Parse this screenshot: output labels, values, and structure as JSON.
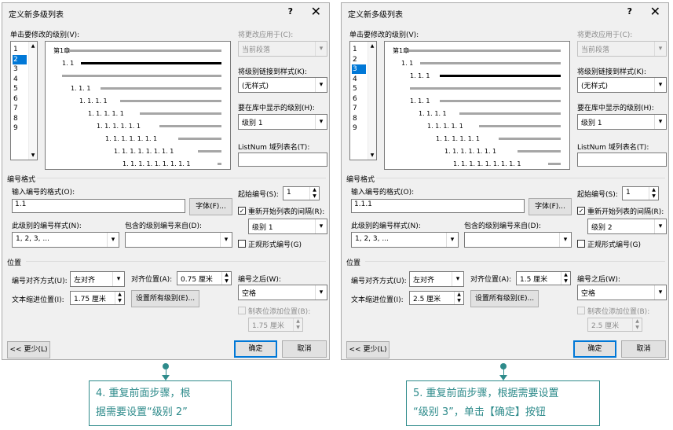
{
  "dialogs": [
    {
      "title": "定义新多级列表",
      "help_glyph": "?",
      "close_glyph": "✕",
      "level_list_label": "单击要修改的级别(V):",
      "levels": [
        "1",
        "2",
        "3",
        "4",
        "5",
        "6",
        "7",
        "8",
        "9"
      ],
      "selected_level_index": 1,
      "preview_lines": [
        {
          "text": "第1章",
          "indent": 0
        },
        {
          "text": "1. 1",
          "indent": 1
        },
        {
          "text": "",
          "indent": 1
        },
        {
          "text": "1. 1. 1",
          "indent": 2
        },
        {
          "text": "1. 1. 1. 1",
          "indent": 3
        },
        {
          "text": "1. 1. 1. 1. 1",
          "indent": 4
        },
        {
          "text": "1. 1. 1. 1. 1. 1",
          "indent": 5
        },
        {
          "text": "1. 1. 1. 1. 1. 1. 1",
          "indent": 6
        },
        {
          "text": "1. 1. 1. 1. 1. 1. 1. 1",
          "indent": 7
        },
        {
          "text": "1. 1. 1. 1. 1. 1. 1. 1. 1",
          "indent": 8
        }
      ],
      "current_preview_line": 1,
      "apply_to_label": "将更改应用于(C):",
      "apply_to_value": "当前段落",
      "link_style_label": "将级别链接到样式(K):",
      "link_style_value": "(无样式)",
      "gallery_level_label": "要在库中显示的级别(H):",
      "gallery_level_value": "级别 1",
      "listnum_label": "ListNum 域列表名(T):",
      "listnum_value": "",
      "number_format_section": "编号格式",
      "enter_format_label": "输入编号的格式(O):",
      "format_value": "1.1",
      "font_button": "字体(F)...",
      "number_style_label": "此级别的编号样式(N):",
      "number_style_value": "1, 2, 3, ...",
      "include_from_label": "包含的级别编号来自(D):",
      "include_from_value": "",
      "start_at_label": "起始编号(S):",
      "start_at_value": "1",
      "restart_label": "重新开始列表的间隔(R):",
      "restart_checked": "✓",
      "restart_value": "级别 1",
      "legal_label": "正规形式编号(G)",
      "position_section": "位置",
      "alignment_label": "编号对齐方式(U):",
      "alignment_value": "左对齐",
      "aligned_at_label": "对齐位置(A):",
      "aligned_at_value": "0.75 厘米",
      "follow_label": "编号之后(W):",
      "follow_value": "空格",
      "indent_label": "文本缩进位置(I):",
      "indent_value": "1.75 厘米",
      "set_all_button": "设置所有级别(E)...",
      "tab_stop_label": "制表位添加位置(B):",
      "tab_stop_value": "1.75 厘米",
      "less_button": "<< 更少(L)",
      "ok_button": "确定",
      "cancel_button": "取消"
    },
    {
      "title": "定义新多级列表",
      "help_glyph": "?",
      "close_glyph": "✕",
      "level_list_label": "单击要修改的级别(V):",
      "levels": [
        "1",
        "2",
        "3",
        "4",
        "5",
        "6",
        "7",
        "8",
        "9"
      ],
      "selected_level_index": 2,
      "preview_lines": [
        {
          "text": "第1章",
          "indent": 0
        },
        {
          "text": "1. 1",
          "indent": 1
        },
        {
          "text": "1. 1. 1",
          "indent": 2
        },
        {
          "text": "",
          "indent": 2
        },
        {
          "text": "1. 1. 1",
          "indent": 2
        },
        {
          "text": "1. 1. 1. 1",
          "indent": 3
        },
        {
          "text": "1. 1. 1. 1. 1",
          "indent": 4
        },
        {
          "text": "1. 1. 1. 1. 1. 1",
          "indent": 5
        },
        {
          "text": "1. 1. 1. 1. 1. 1. 1",
          "indent": 6
        },
        {
          "text": "1. 1. 1. 1. 1. 1. 1. 1. 1",
          "indent": 7
        }
      ],
      "current_preview_line": 2,
      "apply_to_label": "将更改应用于(C):",
      "apply_to_value": "当前段落",
      "link_style_label": "将级别链接到样式(K):",
      "link_style_value": "(无样式)",
      "gallery_level_label": "要在库中显示的级别(H):",
      "gallery_level_value": "级别 1",
      "listnum_label": "ListNum 域列表名(T):",
      "listnum_value": "",
      "number_format_section": "编号格式",
      "enter_format_label": "输入编号的格式(O):",
      "format_value": "1.1.1",
      "font_button": "字体(F)...",
      "number_style_label": "此级别的编号样式(N):",
      "number_style_value": "1, 2, 3, ...",
      "include_from_label": "包含的级别编号来自(D):",
      "include_from_value": "",
      "start_at_label": "起始编号(S):",
      "start_at_value": "1",
      "restart_label": "重新开始列表的间隔(R):",
      "restart_checked": "✓",
      "restart_value": "级别 2",
      "legal_label": "正规形式编号(G)",
      "position_section": "位置",
      "alignment_label": "编号对齐方式(U):",
      "alignment_value": "左对齐",
      "aligned_at_label": "对齐位置(A):",
      "aligned_at_value": "1.5 厘米",
      "follow_label": "编号之后(W):",
      "follow_value": "空格",
      "indent_label": "文本缩进位置(I):",
      "indent_value": "2.5 厘米",
      "set_all_button": "设置所有级别(E)...",
      "tab_stop_label": "制表位添加位置(B):",
      "tab_stop_value": "2.5 厘米",
      "less_button": "<< 更少(L)",
      "ok_button": "确定",
      "cancel_button": "取消"
    }
  ],
  "callouts": [
    {
      "line1": "4. 重复前面步骤，根",
      "line2": "据需要设置“级别 2”"
    },
    {
      "line1": "5. 重复前面步骤，根据需要设置",
      "line2": "“级别 3”，单击【确定】按钮"
    }
  ],
  "colors": {
    "accent": "#0078d7",
    "callout": "#2e8b8b"
  }
}
